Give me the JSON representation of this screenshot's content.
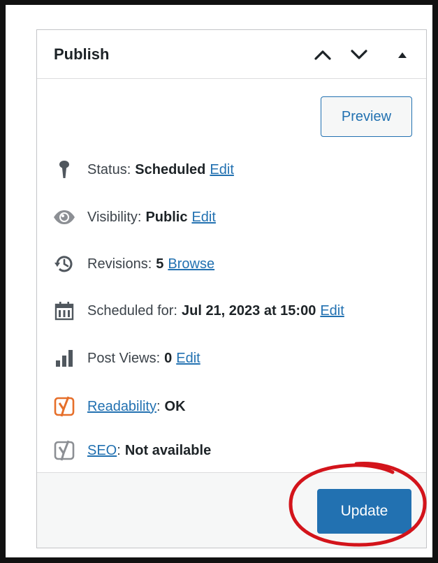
{
  "publish": {
    "title": "Publish",
    "preview_label": "Preview",
    "update_label": "Update",
    "rows": {
      "status": {
        "label": "Status:",
        "value": "Scheduled",
        "link": "Edit"
      },
      "visibility": {
        "label": "Visibility:",
        "value": "Public",
        "link": "Edit"
      },
      "revisions": {
        "label": "Revisions:",
        "value": "5",
        "link": "Browse"
      },
      "scheduled": {
        "label": "Scheduled for:",
        "value": "Jul 21, 2023 at 15:00",
        "link": "Edit"
      },
      "views": {
        "label": "Post Views:",
        "value": "0",
        "link": "Edit"
      },
      "readability": {
        "link": "Readability",
        "suffix": ":",
        "value": "OK"
      },
      "seo": {
        "link": "SEO",
        "suffix": ":",
        "value": "Not available"
      }
    }
  },
  "icons": {
    "status": "pin-icon",
    "visibility": "eye-icon",
    "revisions": "history-icon",
    "scheduled": "calendar-icon",
    "views": "bar-chart-icon",
    "readability": "yoast-readability-icon",
    "seo": "yoast-seo-icon"
  },
  "colors": {
    "accent": "#2271b1",
    "readability_icon": "#e66f2a",
    "seo_icon": "#8c8f94",
    "annotation": "#d3141b"
  }
}
